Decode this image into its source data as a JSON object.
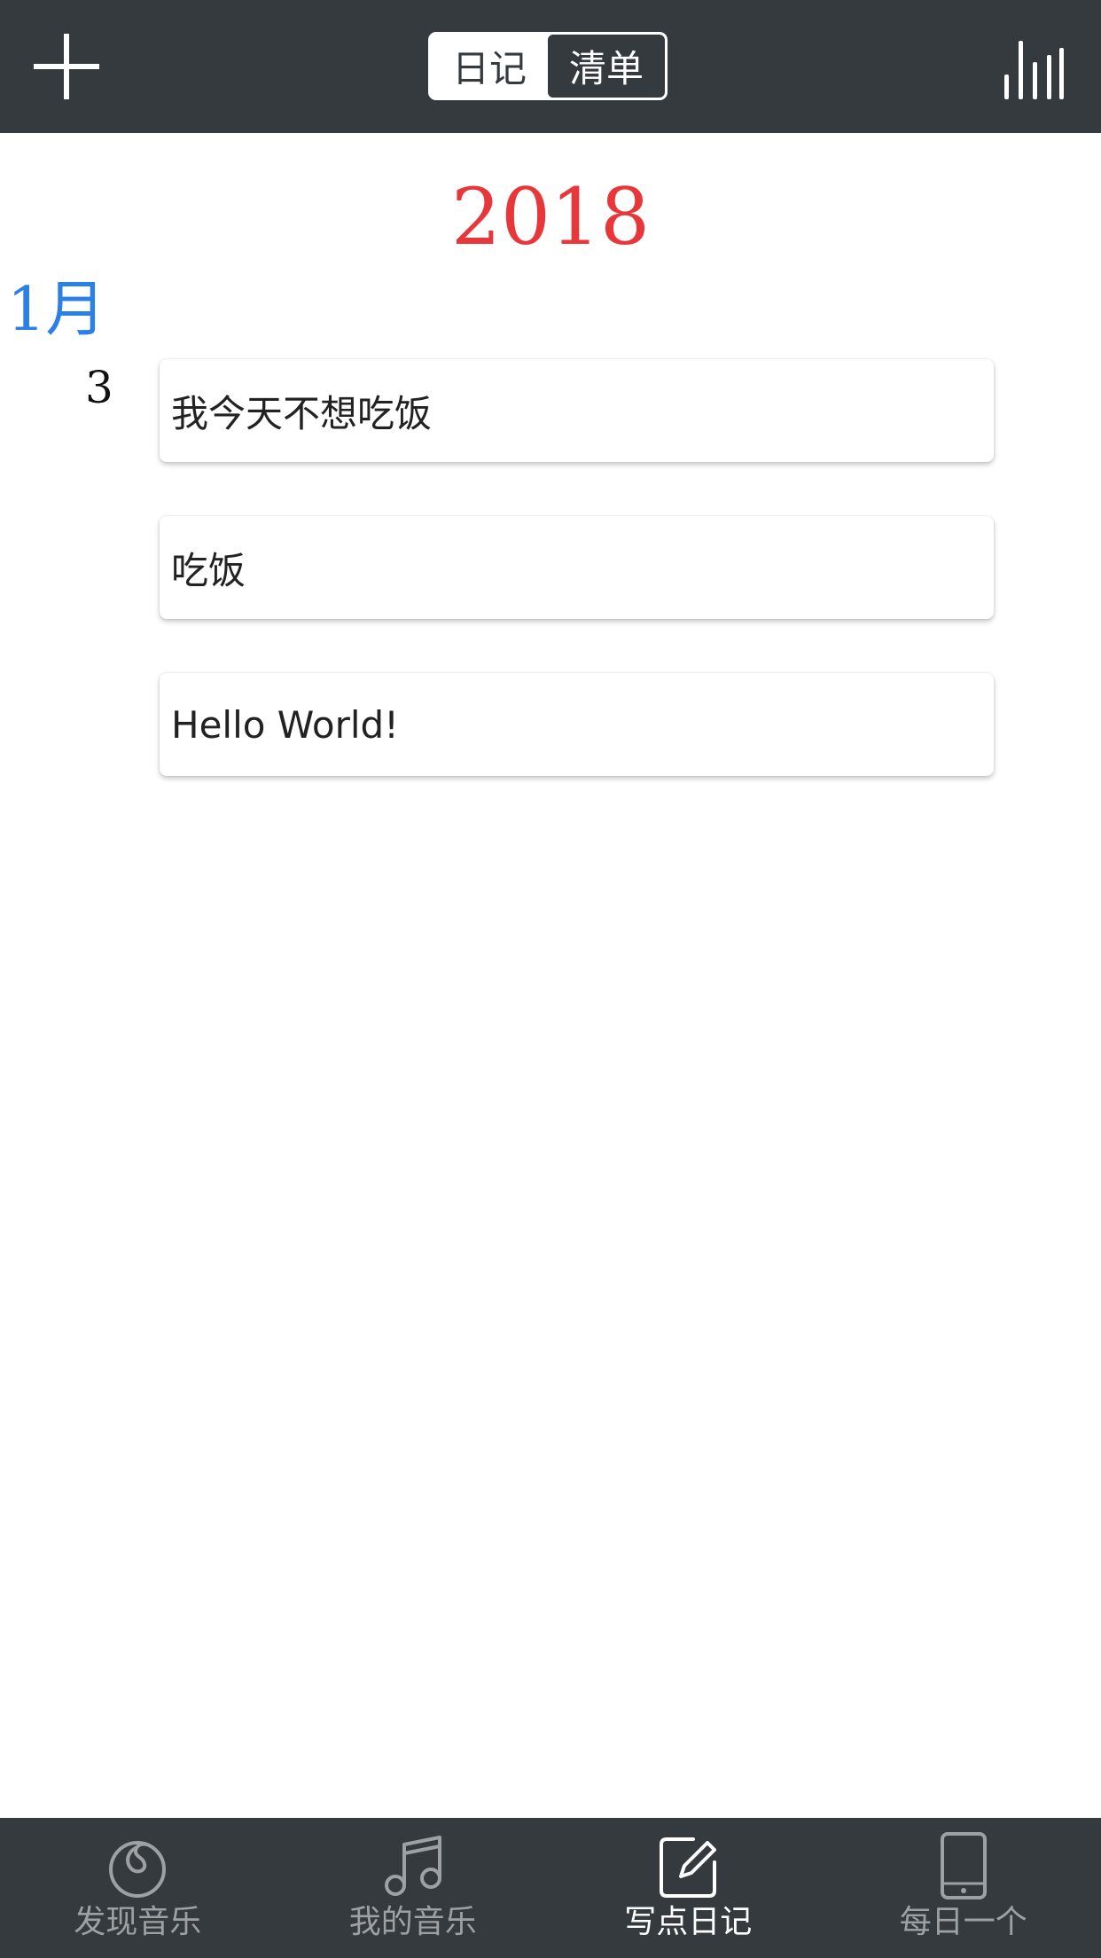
{
  "header": {
    "add_icon": "plus-icon",
    "segment": {
      "items": [
        {
          "label": "日记",
          "active": false
        },
        {
          "label": "清单",
          "active": true
        }
      ]
    },
    "stats_icon": "bar-chart-icon"
  },
  "timeline": {
    "year": "2018",
    "month": "1月",
    "day": "3",
    "entries": [
      {
        "text": "我今天不想吃饭"
      },
      {
        "text": "吃饭"
      },
      {
        "text": "Hello World!"
      }
    ]
  },
  "bottom_nav": {
    "items": [
      {
        "label": "发现音乐",
        "icon": "netease-music-icon",
        "active": false
      },
      {
        "label": "我的音乐",
        "icon": "music-note-icon",
        "active": false
      },
      {
        "label": "写点日记",
        "icon": "edit-note-icon",
        "active": true
      },
      {
        "label": "每日一个",
        "icon": "phone-icon",
        "active": false
      }
    ]
  },
  "colors": {
    "bar_background": "#353a3e",
    "year": "#e8373a",
    "month": "#2a80e6",
    "nav_inactive": "#9ea1a4",
    "nav_active": "#ffffff"
  }
}
